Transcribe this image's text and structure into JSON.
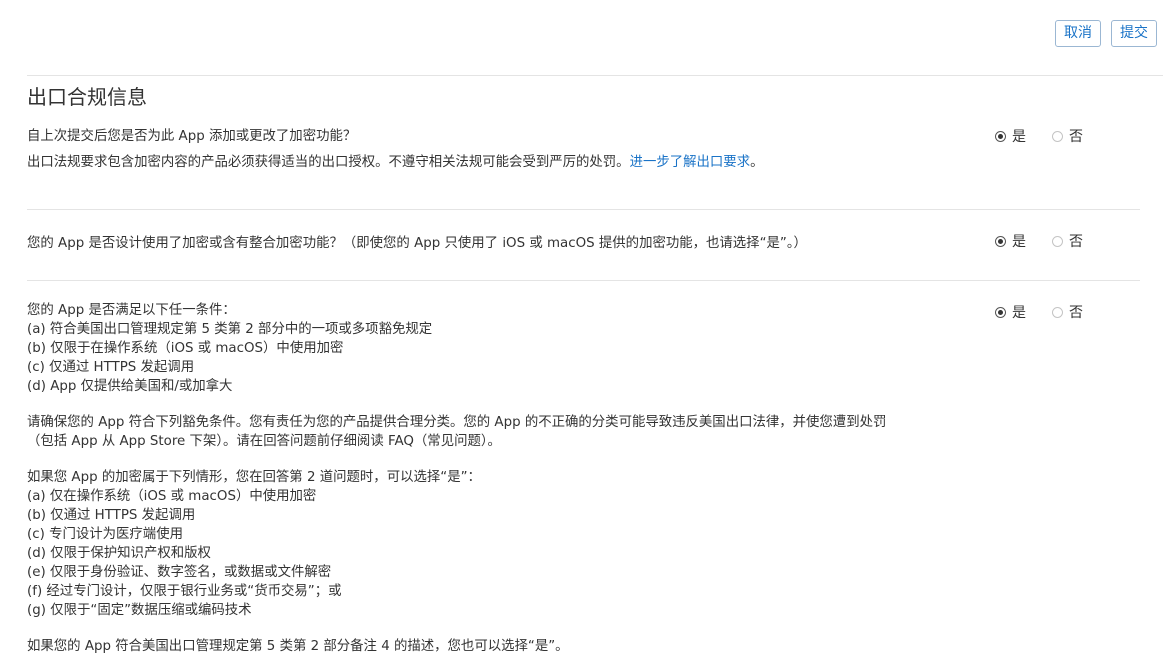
{
  "toolbar": {
    "cancel_label": "取消",
    "submit_label": "提交"
  },
  "page_title": "出口合规信息",
  "radio_labels": {
    "yes": "是",
    "no": "否"
  },
  "questions": [
    {
      "question": "自上次提交后您是否为此 App 添加或更改了加密功能？",
      "note": "出口法规要求包含加密内容的产品必须获得适当的出口授权。不遵守相关法规可能会受到严厉的处罚。",
      "link_text": "进一步了解出口要求",
      "note_end": "。",
      "selected": "yes"
    },
    {
      "question": "您的 App 是否设计使用了加密或含有整合加密功能？（即使您的 App 只使用了 iOS 或 macOS 提供的加密功能，也请选择“是”。）",
      "selected": "yes"
    },
    {
      "question": "您的 App 是否满足以下任一条件：",
      "conditions": [
        "(a) 符合美国出口管理规定第 5 类第 2 部分中的一项或多项豁免规定",
        "(b) 仅限于在操作系统（iOS 或 macOS）中使用加密",
        "(c) 仅通过 HTTPS 发起调用",
        "(d) App 仅提供给美国和/或加拿大"
      ],
      "paragraph1": [
        "请确保您的 App 符合下列豁免条件。您有责任为您的产品提供合理分类。您的 App 的不正确的分类可能导致违反美国出口法律，并使您遭到处罚",
        "（包括 App 从 App Store 下架）。请在回答问题前仔细阅读 FAQ（常见问题）。"
      ],
      "paragraph2_intro": "如果您 App 的加密属于下列情形，您在回答第 2 道问题时，可以选择“是”：",
      "cases": [
        "(a) 仅在操作系统（iOS 或 macOS）中使用加密",
        "(b) 仅通过 HTTPS 发起调用",
        "(c) 专门设计为医疗端使用",
        "(d) 仅限于保护知识产权和版权",
        "(e) 仅限于身份验证、数字签名，或数据或文件解密",
        "(f) 经过专门设计，仅限于银行业务或“货币交易”；或",
        "(g) 仅限于“固定”数据压缩或编码技术"
      ],
      "paragraph3": "如果您的 App 符合美国出口管理规定第 5 类第 2 部分备注 4 的描述，您也可以选择“是”。",
      "selected": "yes"
    }
  ]
}
